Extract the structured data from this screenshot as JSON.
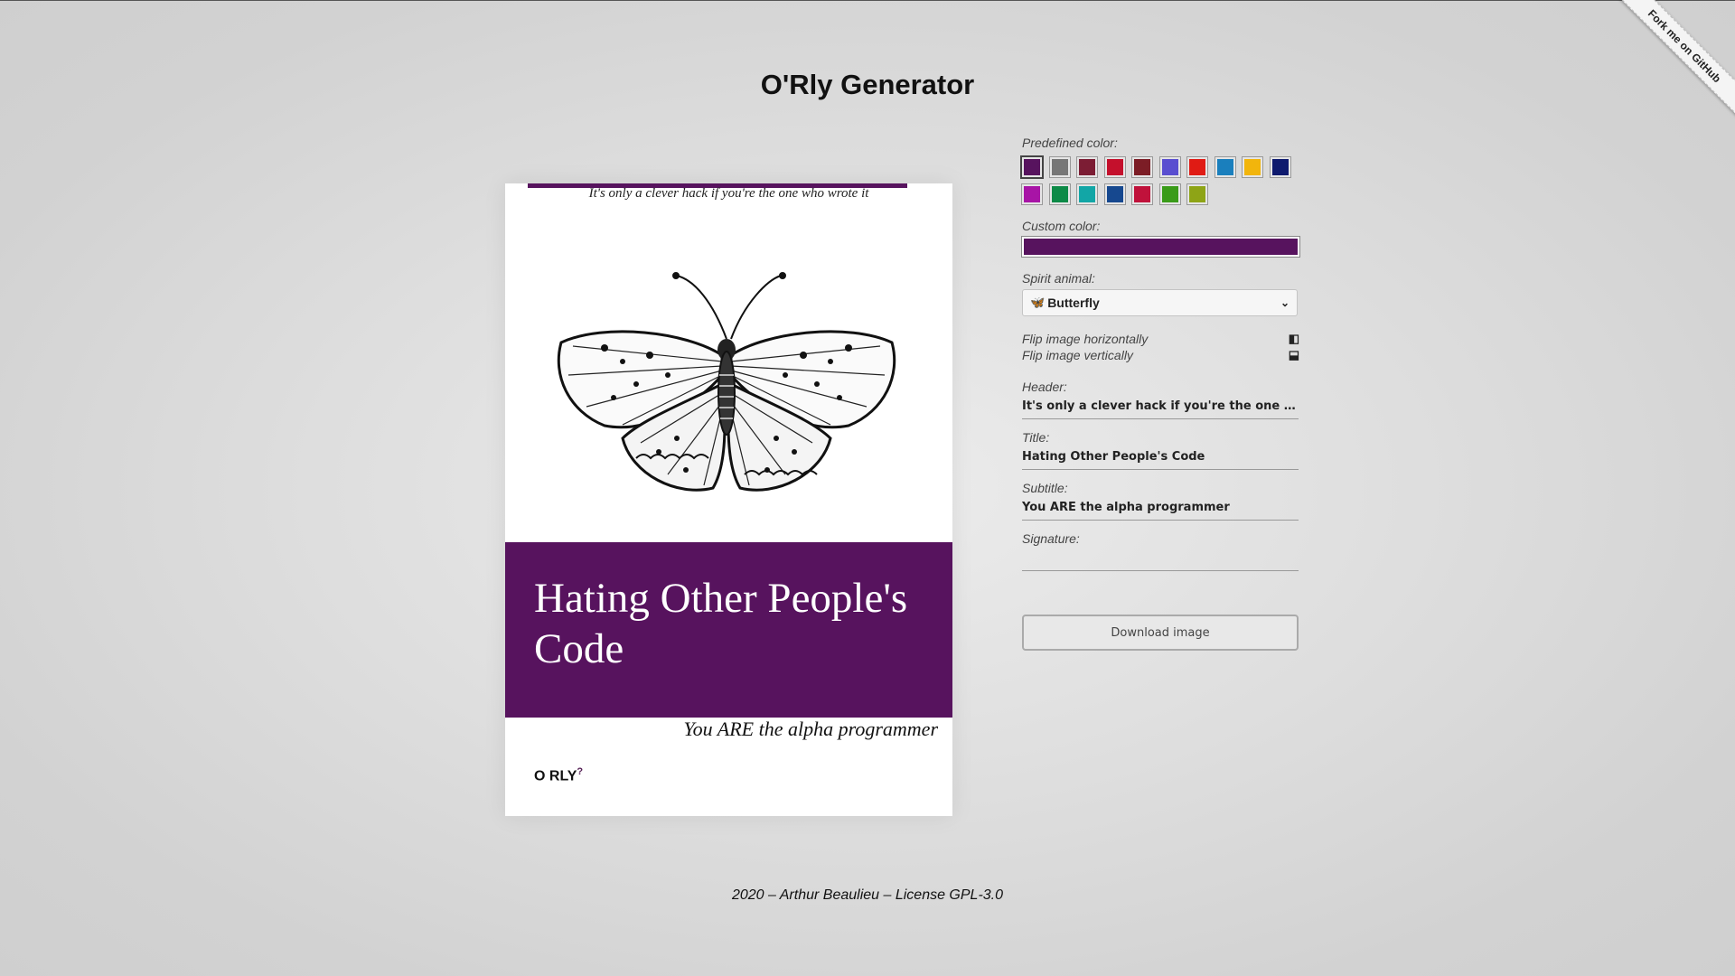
{
  "page": {
    "title": "O'Rly Generator",
    "footer": "2020 – Arthur Beaulieu – License GPL-3.0"
  },
  "ribbon": {
    "label": "Fork me on GitHub"
  },
  "cover": {
    "header": "It's only a clever hack if you're the one who wrote it",
    "title": "Hating Other People's Code",
    "subtitle": "You ARE the alpha programmer",
    "logo_text": "O RLY",
    "logo_sup": "?",
    "color": "#57135e",
    "animal_icon": "butterfly-illustration"
  },
  "panel": {
    "predefined_color_label": "Predefined color:",
    "predefined_colors": [
      "#57135e",
      "#777777",
      "#7c1d34",
      "#c4102c",
      "#7c1d26",
      "#5a4ed0",
      "#e01b14",
      "#1a7fbd",
      "#f2b50c",
      "#0e1a6e",
      "#a814a6",
      "#0d8a47",
      "#12a6a6",
      "#16488f",
      "#c0123b",
      "#3a9b19",
      "#8ea416"
    ],
    "selected_color_index": 0,
    "custom_color_label": "Custom color:",
    "custom_color": "#57135e",
    "spirit_animal_label": "Spirit animal:",
    "spirit_animal_value": "Butterfly",
    "flip_horizontal_label": "Flip image horizontally",
    "flip_vertical_label": "Flip image vertically",
    "header_label": "Header:",
    "header_value": "It's only a clever hack if you're the one who ...",
    "title_label": "Title:",
    "title_value": "Hating Other People's Code",
    "subtitle_label": "Subtitle:",
    "subtitle_value": "You ARE the alpha programmer",
    "signature_label": "Signature:",
    "signature_value": "",
    "download_label": "Download image"
  }
}
